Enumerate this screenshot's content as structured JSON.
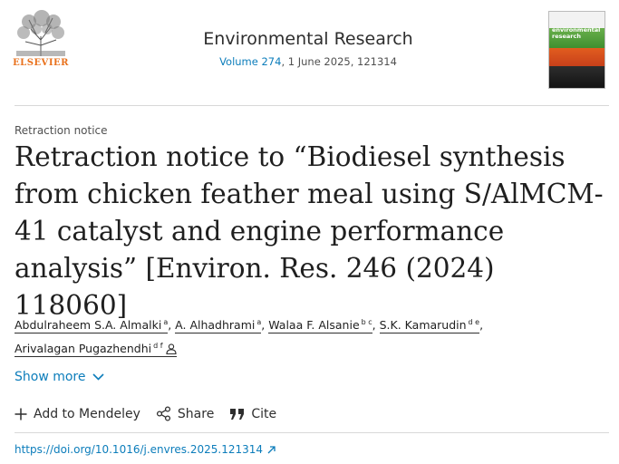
{
  "publisher": {
    "logo_icon": "elsevier-tree-logo",
    "name": "ELSEVIER",
    "brand_color": "#e9711c"
  },
  "journal": {
    "name": "Environmental Research",
    "volume_link": "Volume 274",
    "date_and_id": ", 1 June 2025, 121314",
    "cover_title_line1": "environmental",
    "cover_title_line2": "research"
  },
  "article": {
    "type": "Retraction notice",
    "title": "Retraction notice to “Biodiesel synthesis from chicken feather meal using S/AlMCM-41 catalyst and engine performance analysis” [Environ. Res. 246 (2024) 118060]",
    "authors": [
      {
        "name": "Abdulraheem S.A. Almalki",
        "sup": "a",
        "sep": ", "
      },
      {
        "name": "A. Alhadhrami",
        "sup": "a",
        "sep": ", "
      },
      {
        "name": "Walaa F. Alsanie",
        "sup": "b c",
        "sep": ", "
      },
      {
        "name": "S.K. Kamarudin",
        "sup": "d e",
        "sep": ", "
      },
      {
        "name": "Arivalagan Pugazhendhi",
        "sup": "d f",
        "sep": ""
      }
    ],
    "corresponding_icon": "person-icon"
  },
  "show_more": {
    "label": "Show more",
    "icon": "chevron-down-icon"
  },
  "actions": {
    "mendeley_label": "Add to Mendeley",
    "share_label": "Share",
    "cite_label": "Cite"
  },
  "doi": {
    "url": "https://doi.org/10.1016/j.envres.2025.121314",
    "icon": "external-link-icon"
  },
  "colors": {
    "link": "#0c7dbb",
    "text": "#2e2e2e"
  }
}
